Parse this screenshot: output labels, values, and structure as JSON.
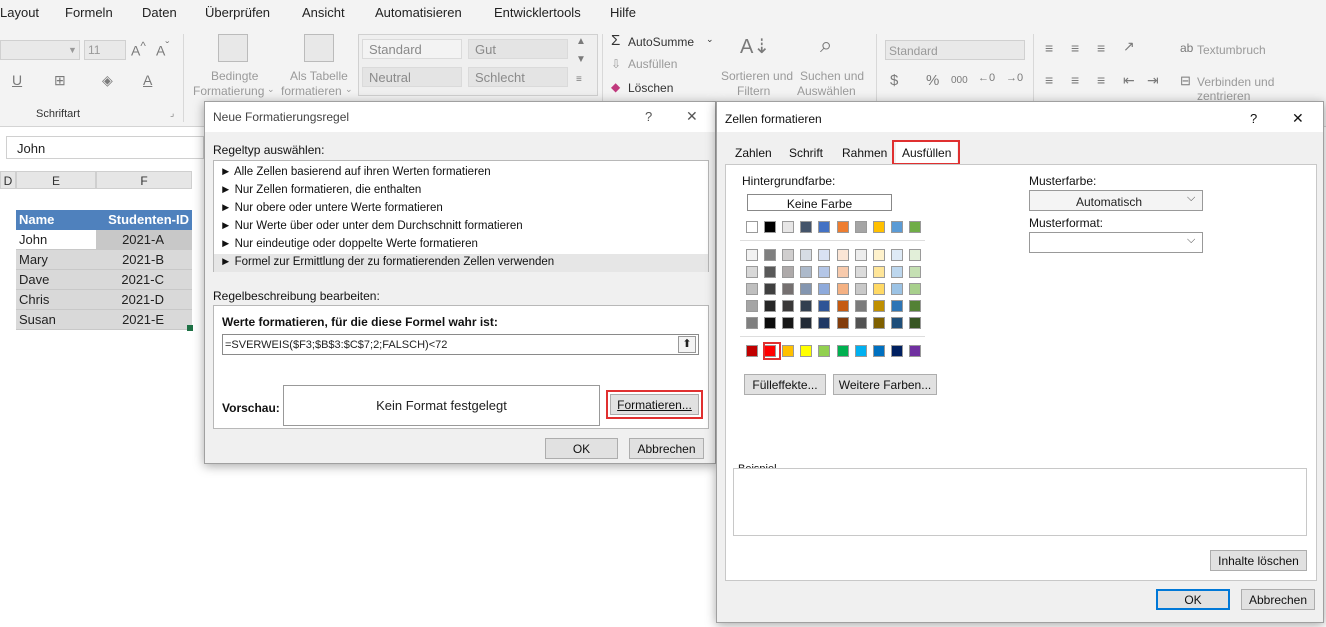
{
  "menubar": {
    "items": [
      "Layout",
      "Formeln",
      "Daten",
      "Überprüfen",
      "Ansicht",
      "Automatisieren",
      "Entwicklertools",
      "Hilfe"
    ]
  },
  "ribbon": {
    "font_size": "11",
    "group_font": "Schriftart",
    "cond_format_1": "Bedingte",
    "cond_format_2": "Formatierung",
    "as_table_1": "Als Tabelle",
    "as_table_2": "formatieren",
    "styles": [
      "Standard",
      "Gut",
      "Neutral",
      "Schlecht"
    ],
    "autosum": "AutoSumme",
    "fill": "Ausfüllen",
    "delete": "Löschen",
    "sort_1": "Sortieren und",
    "sort_2": "Filtern",
    "search_1": "Suchen und",
    "search_2": "Auswählen",
    "number_format": "Standard",
    "wrap": "Textumbruch",
    "merge": "Verbinden und zentrieren"
  },
  "formula_bar": {
    "value": "John"
  },
  "sheet": {
    "col_headers": [
      "D",
      "E",
      "F"
    ],
    "header": [
      "Name",
      "Studenten-ID"
    ],
    "rows": [
      [
        "John",
        "2021-A"
      ],
      [
        "Mary",
        "2021-B"
      ],
      [
        "Dave",
        "2021-C"
      ],
      [
        "Chris",
        "2021-D"
      ],
      [
        "Susan",
        "2021-E"
      ]
    ]
  },
  "rule_dialog": {
    "title": "Neue Formatierungsregel",
    "help": "?",
    "close": "✕",
    "rule_type_label": "Regeltyp auswählen:",
    "rule_types": [
      "► Alle Zellen basierend auf ihren Werten formatieren",
      "► Nur Zellen formatieren, die enthalten",
      "► Nur obere oder untere Werte formatieren",
      "► Nur Werte über oder unter dem Durchschnitt formatieren",
      "► Nur eindeutige oder doppelte Werte formatieren",
      "► Formel zur Ermittlung der zu formatierenden Zellen verwenden"
    ],
    "desc_label": "Regelbeschreibung bearbeiten:",
    "formula_label": "Werte formatieren, für die diese Formel wahr ist:",
    "formula": "=SVERWEIS($F3;$B$3:$C$7;2;FALSCH)<72",
    "preview_label": "Vorschau:",
    "preview_text": "Kein Format festgelegt",
    "format_button": "Formatieren...",
    "ok": "OK",
    "cancel": "Abbrechen"
  },
  "format_dialog": {
    "title": "Zellen formatieren",
    "help": "?",
    "close": "✕",
    "tabs": [
      "Zahlen",
      "Schrift",
      "Rahmen",
      "Ausfüllen"
    ],
    "bg_label": "Hintergrundfarbe:",
    "no_color": "Keine Farbe",
    "pattern_color_label": "Musterfarbe:",
    "pattern_color_value": "Automatisch",
    "pattern_style_label": "Musterformat:",
    "fill_effects": "Fülleffekte...",
    "more_colors": "Weitere Farben...",
    "sample_label": "Beispiel",
    "clear": "Inhalte löschen",
    "ok": "OK",
    "cancel": "Abbrechen",
    "theme_row": [
      "#ffffff",
      "#000000",
      "#e7e6e6",
      "#44546a",
      "#4472c4",
      "#ed7d31",
      "#a5a5a5",
      "#ffc000",
      "#5b9bd5",
      "#70ad47"
    ],
    "tint_rows": [
      [
        "#f2f2f2",
        "#7f7f7f",
        "#d0cece",
        "#d6dce4",
        "#d9e2f3",
        "#fbe5d5",
        "#ededed",
        "#fff2cc",
        "#deeaf6",
        "#e2efd9"
      ],
      [
        "#d8d8d8",
        "#595959",
        "#aeaaaa",
        "#acb9ca",
        "#b4c6e7",
        "#f7caac",
        "#dbdbdb",
        "#fee599",
        "#bdd7ee",
        "#c5e0b3"
      ],
      [
        "#bfbfbf",
        "#3f3f3f",
        "#757070",
        "#8496b0",
        "#8eaadb",
        "#f4b183",
        "#c9c9c9",
        "#ffd965",
        "#9cc3e5",
        "#a8d08d"
      ],
      [
        "#a5a5a5",
        "#262626",
        "#3a3838",
        "#323f4f",
        "#2f5496",
        "#c55a11",
        "#7b7b7b",
        "#bf8f00",
        "#2e75b5",
        "#538135"
      ],
      [
        "#7f7f7f",
        "#0c0c0c",
        "#161616",
        "#222a35",
        "#1f3864",
        "#833c0b",
        "#525252",
        "#7f6000",
        "#1e4e79",
        "#375623"
      ]
    ],
    "standard_row": [
      "#c00000",
      "#ff0000",
      "#ffc000",
      "#ffff00",
      "#92d050",
      "#00b050",
      "#00b0f0",
      "#0070c0",
      "#002060",
      "#7030a0"
    ]
  }
}
